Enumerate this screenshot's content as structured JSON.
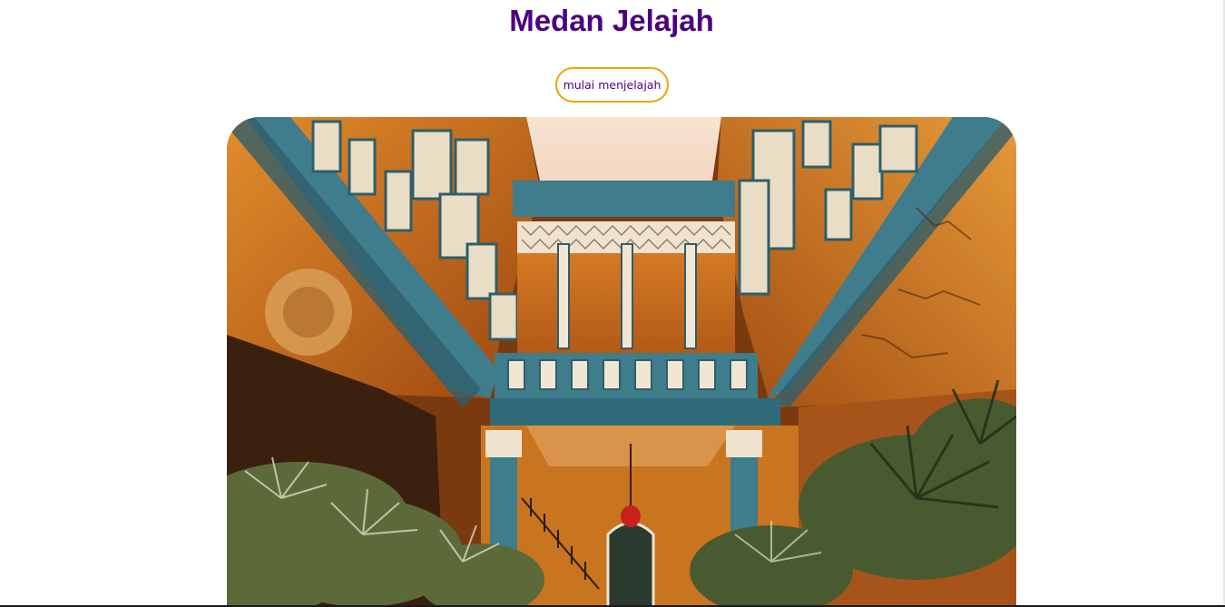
{
  "page": {
    "title": "Medan Jelajah",
    "cta_label": "mulai menjelajah"
  },
  "hero_image": {
    "subject": "colonial-courtyard-photo",
    "colors": {
      "wall": "#c8651a",
      "timber": "#3f7c8c",
      "shutter": "#efe3cf",
      "sky": "#f7e6d6",
      "foliage": "#5c6a3a"
    }
  },
  "colors": {
    "title": "#4b0082",
    "button_border": "#f0a500",
    "button_text": "#4b0082"
  }
}
